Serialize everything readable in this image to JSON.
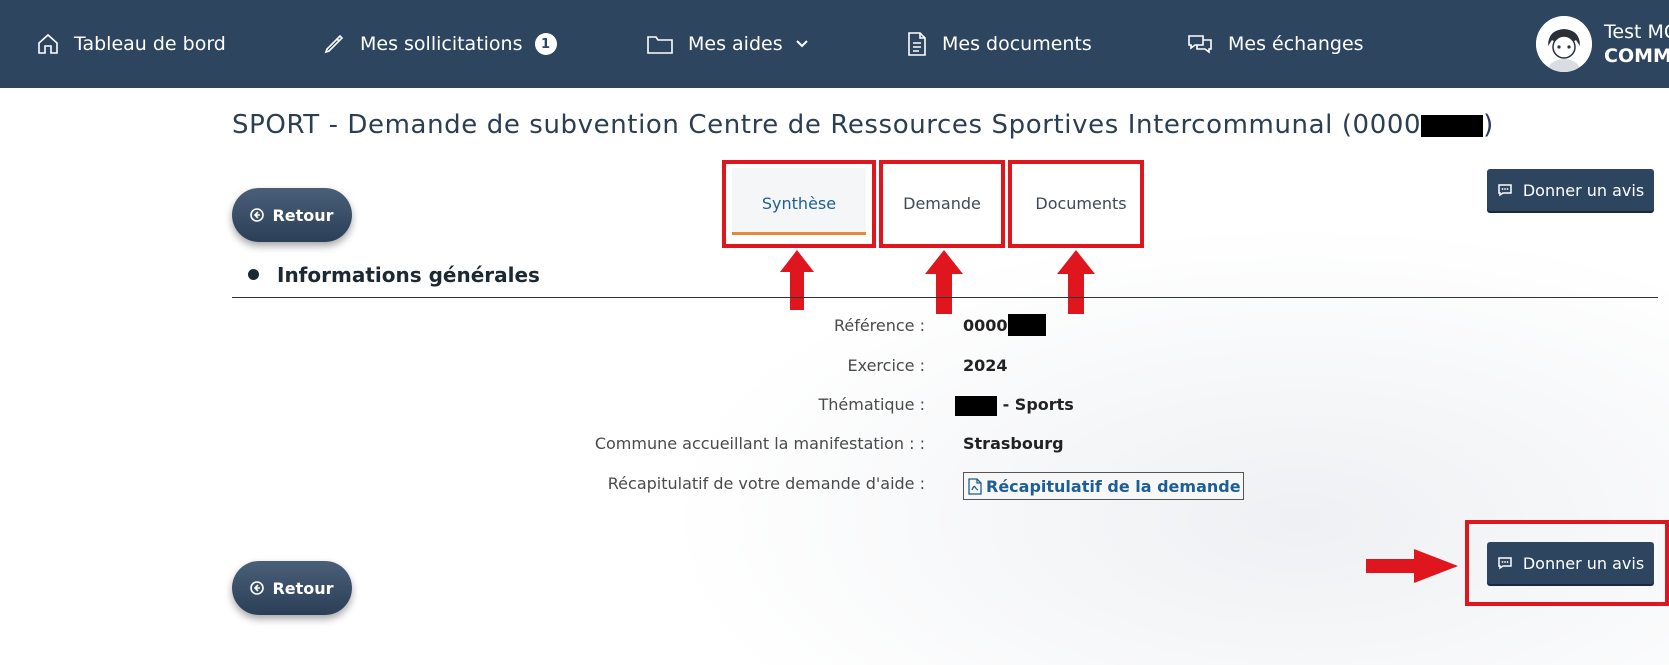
{
  "nav": {
    "items": [
      {
        "label": "Tableau de bord",
        "icon": "home-icon"
      },
      {
        "label": "Mes sollicitations",
        "icon": "pen-icon",
        "badge": "1"
      },
      {
        "label": "Mes aides",
        "icon": "folder-icon"
      },
      {
        "label": "Mes documents",
        "icon": "document-icon"
      },
      {
        "label": "Mes échanges",
        "icon": "chat-icon"
      }
    ],
    "user": {
      "name": "Test MO",
      "role": "COMMU"
    }
  },
  "page": {
    "title": "SPORT - Demande de subvention Centre de Ressources Sportives Intercommunal (0000",
    "title_suffix": ")",
    "retour_label": "Retour",
    "avis_label": "Donner un avis"
  },
  "tabs": [
    {
      "label": "Synthèse",
      "active": true
    },
    {
      "label": "Demande",
      "active": false
    },
    {
      "label": "Documents",
      "active": false
    }
  ],
  "section": {
    "title": "Informations générales",
    "rows": [
      {
        "label": "Référence :",
        "value": "0000"
      },
      {
        "label": "Exercice :",
        "value": "2024"
      },
      {
        "label": "Thématique :",
        "value": "- Sports"
      },
      {
        "label": "Commune accueillant la manifestation : :",
        "value": "Strasbourg"
      },
      {
        "label": "Récapitulatif de votre demande d'aide :",
        "value": "Récapitulatif de la demande"
      }
    ]
  },
  "colors": {
    "nav_bg": "#2e4560",
    "accent": "#e8893a",
    "link": "#1d5f95",
    "annotation_red": "#e0161e"
  }
}
